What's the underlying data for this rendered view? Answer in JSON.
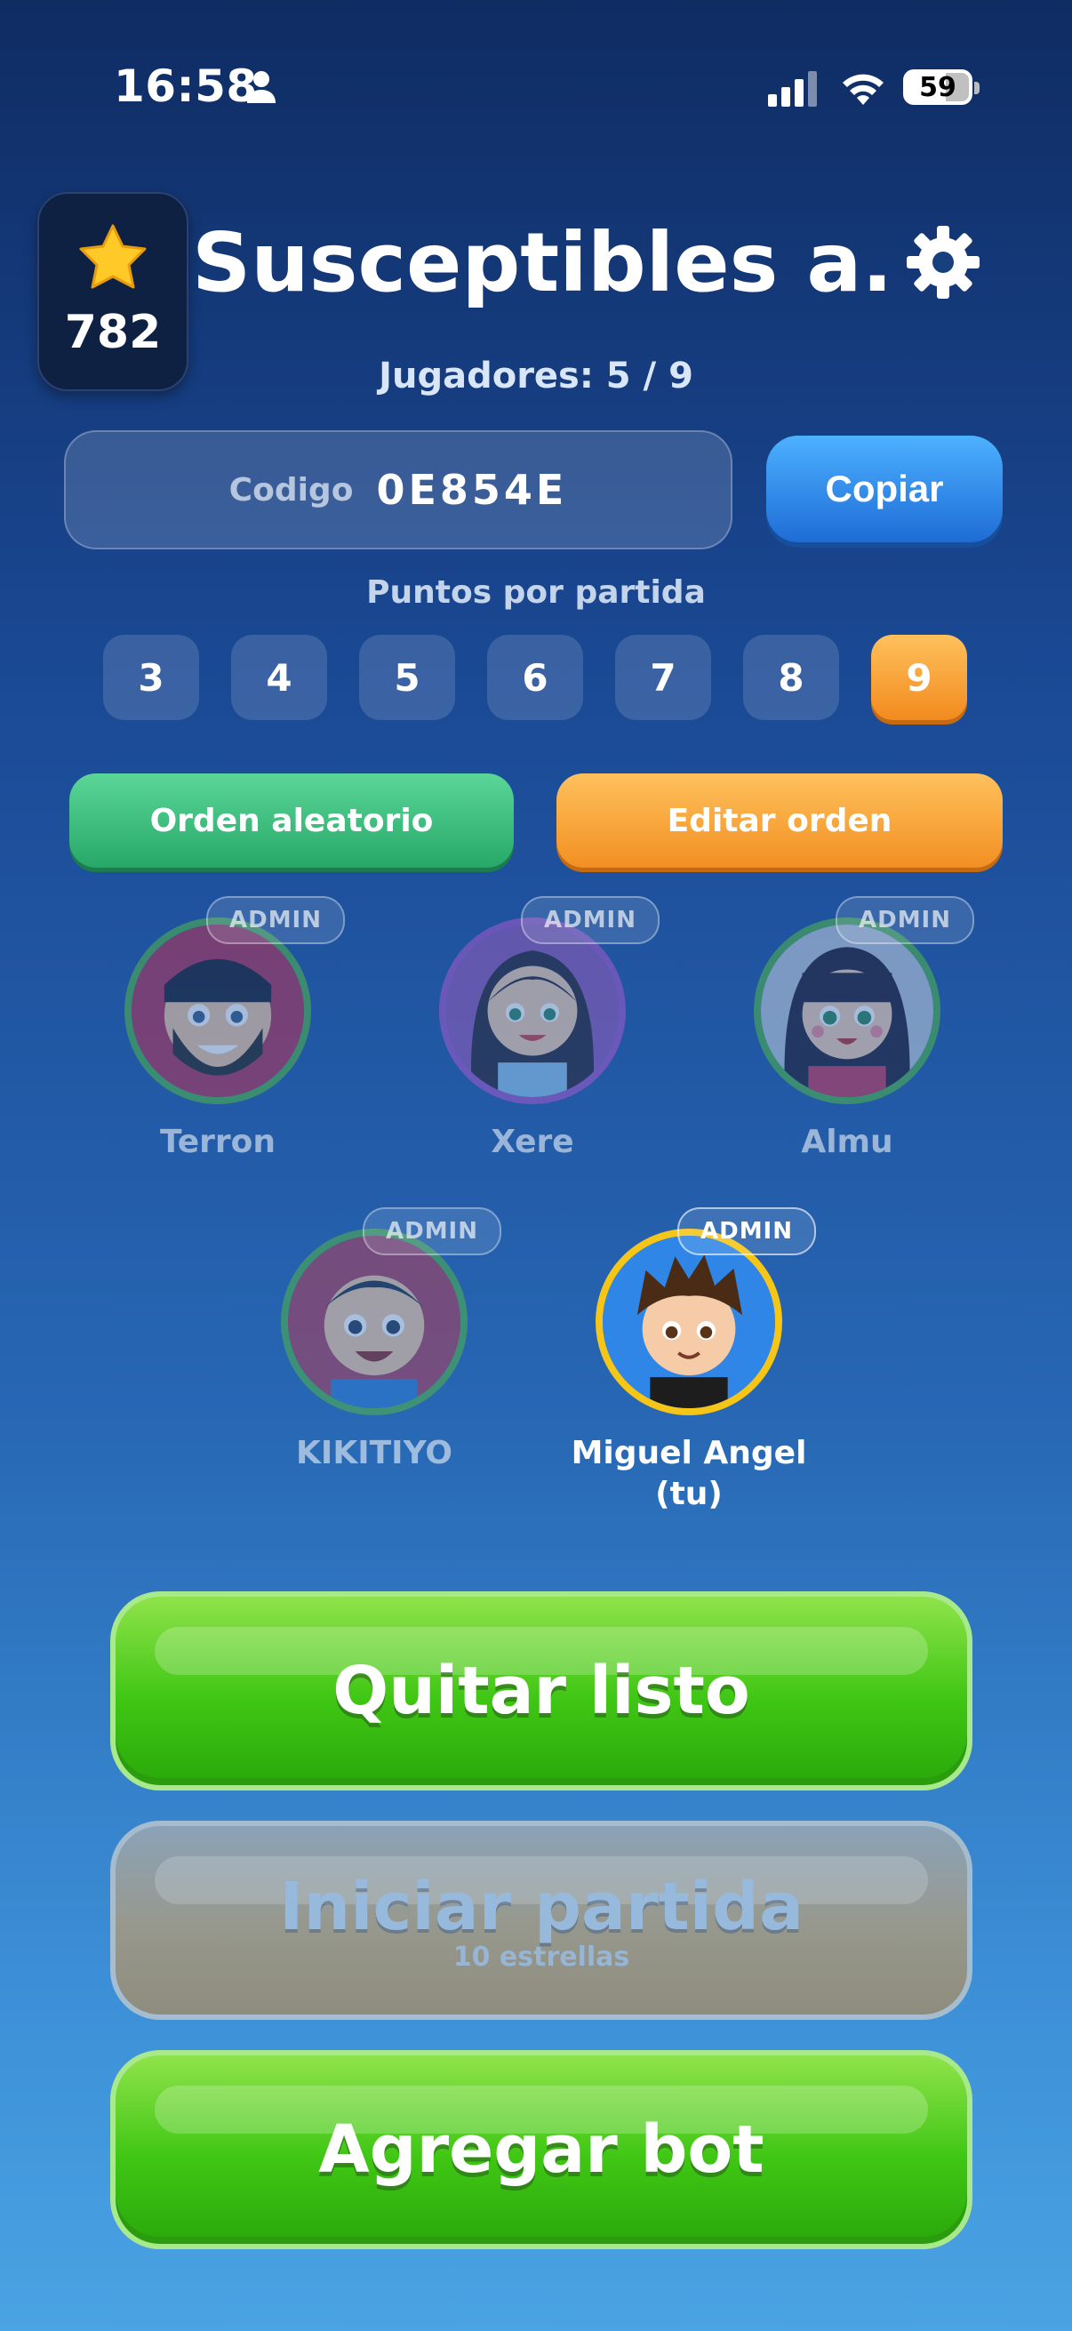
{
  "status_bar": {
    "time": "16:58",
    "battery": "59"
  },
  "header": {
    "stars": "782",
    "room_name": "Susceptibles a...",
    "players": "Jugadores: 5 / 9"
  },
  "code": {
    "label": "Codigo",
    "value": "0E854E",
    "copy_label": "Copiar"
  },
  "points": {
    "label": "Puntos por partida",
    "options": [
      "3",
      "4",
      "5",
      "6",
      "7",
      "8",
      "9"
    ],
    "selected": "9"
  },
  "order": {
    "random_label": "Orden aleatorio",
    "edit_label": "Editar orden"
  },
  "players": [
    {
      "name": "Terron",
      "badge": "ADMIN",
      "ring_color": "#4caf50"
    },
    {
      "name": "Xere",
      "badge": "ADMIN",
      "ring_color": "#9b59c9"
    },
    {
      "name": "Almu",
      "badge": "ADMIN",
      "ring_color": "#4caf50"
    },
    {
      "name": "KIKITIYO",
      "badge": "ADMIN",
      "ring_color": "#4caf50"
    },
    {
      "name": "Miguel Angel\n(tu)",
      "badge": "ADMIN",
      "ring_color": "#f5c518"
    }
  ],
  "actions": {
    "ready_label": "Quitar listo",
    "start_label": "Iniciar partida",
    "start_cost": "10 estrellas",
    "bot_label": "Agregar bot"
  },
  "colors": {
    "accent_orange": "#f28a1e",
    "accent_green": "#3fc614",
    "accent_blue": "#1e6cd6"
  }
}
